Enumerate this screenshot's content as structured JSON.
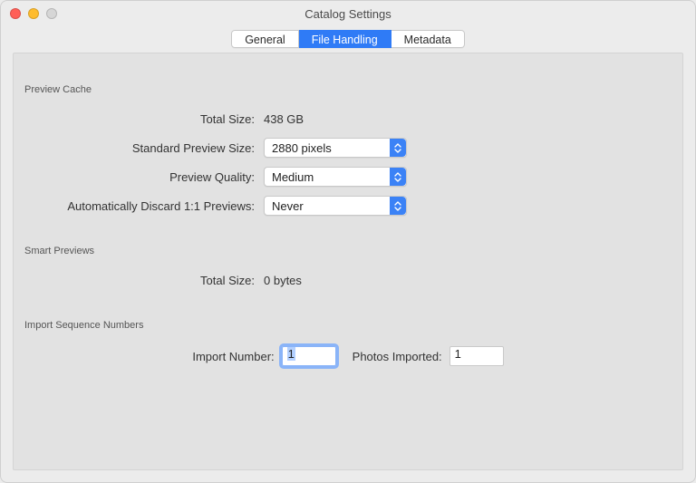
{
  "window": {
    "title": "Catalog Settings"
  },
  "tabs": {
    "general": "General",
    "file_handling": "File Handling",
    "metadata": "Metadata"
  },
  "preview_cache": {
    "group_label": "Preview Cache",
    "total_size_label": "Total Size:",
    "total_size_value": "438 GB",
    "standard_preview_size_label": "Standard Preview Size:",
    "standard_preview_size_value": "2880 pixels",
    "preview_quality_label": "Preview Quality:",
    "preview_quality_value": "Medium",
    "auto_discard_label": "Automatically Discard 1:1 Previews:",
    "auto_discard_value": "Never"
  },
  "smart_previews": {
    "group_label": "Smart Previews",
    "total_size_label": "Total Size:",
    "total_size_value": "0 bytes"
  },
  "import_sequence": {
    "group_label": "Import Sequence Numbers",
    "import_number_label": "Import Number:",
    "import_number_value": "1",
    "photos_imported_label": "Photos Imported:",
    "photos_imported_value": "1"
  }
}
